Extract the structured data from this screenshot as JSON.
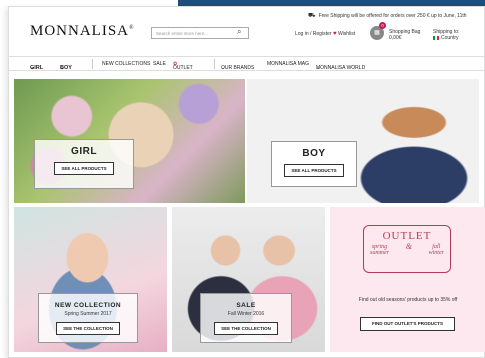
{
  "header": {
    "promo_text": "Free Shipping will be offered for orders over 250 € up to June, 11th",
    "logo": "MONNALISA",
    "logo_mark": "®",
    "search_placeholder": "Search entire store here...",
    "login": "Log in / Register",
    "wishlist": "Wishlist",
    "bag_count": "0",
    "bag_label": "Shopping Bag",
    "bag_amount": "0,00€",
    "ship_label": "Shipping to:",
    "ship_country": "Country"
  },
  "nav": {
    "girl": "GIRL",
    "boy": "BOY",
    "new_collections": "NEW COLLECTIONS",
    "sale": "SALE",
    "outlet": "OUTLET",
    "our_brands": "OUR BRANDS",
    "mag": "MONNALISA MAG",
    "world": "MONNALISA WORLD"
  },
  "tiles": {
    "girl": {
      "title": "GIRL",
      "button": "SEE ALL PRODUCTS"
    },
    "boy": {
      "title": "BOY",
      "button": "SEE ALL PRODUCTS"
    },
    "new": {
      "title": "NEW COLLECTION",
      "subtitle": "Spring Summer 2017",
      "button": "SEE THE COLLECTION"
    },
    "sale": {
      "title": "SALE",
      "subtitle": "Fall Winter 2016",
      "button": "SEE THE COLLECTION"
    },
    "outlet": {
      "title": "OUTLET",
      "spring": "spring",
      "summer": "summer",
      "amp": "&",
      "fall": "fall",
      "winter": "winter",
      "desc": "Find out old seasons' products up to 35% off",
      "button": "FIND OUT OUTLET'S PRODUCTS"
    }
  },
  "colors": {
    "accent": "#b43a5b",
    "header_strip": "#1f4e79",
    "outlet_bg": "#fde8ef"
  },
  "icons": {
    "truck": "truck-icon",
    "search": "search-icon",
    "heart": "heart-icon",
    "bag": "bag-icon",
    "chevron": "chevron-down-icon"
  }
}
